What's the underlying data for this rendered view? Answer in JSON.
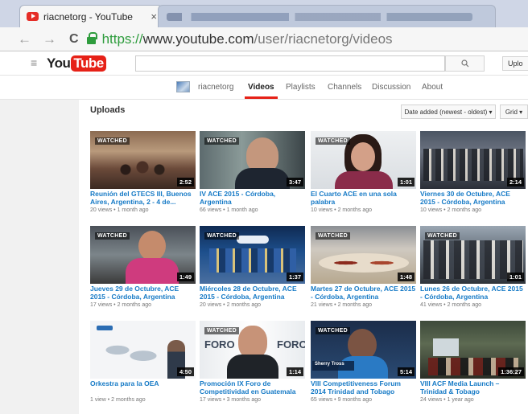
{
  "browser": {
    "tab_title": "riacnetorg - YouTube",
    "tab_close": "×",
    "url_https": "https://",
    "url_host": "www.youtube.com",
    "url_path": "/user/riacnetorg/videos",
    "back": "←",
    "forward": "→",
    "reload": "C"
  },
  "header": {
    "logo_you": "You",
    "logo_tube": "Tube",
    "upload_label": "Uplo"
  },
  "channel_nav": {
    "name": "riacnetorg",
    "tabs": [
      "Videos",
      "Playlists",
      "Channels",
      "Discussion",
      "About"
    ],
    "active": "Videos"
  },
  "uploads": {
    "title": "Uploads",
    "sort_label": "Date added (newest - oldest) ▾",
    "view_label": "Grid ▾"
  },
  "watched_label": "WATCHED",
  "videos": [
    {
      "title": "Reunión del GTECS III, Buenos Aires, Argentina, 2 - 4 de...",
      "meta": "20 views • 1 month ago",
      "duration": "2:52",
      "watched": true
    },
    {
      "title": "IV ACE 2015 - Córdoba, Argentina",
      "meta": "66 views • 1 month ago",
      "duration": "3:47",
      "watched": true
    },
    {
      "title": "El Cuarto ACE en una sola palabra",
      "meta": "10 views • 2 months ago",
      "duration": "1:01",
      "watched": true
    },
    {
      "title": "Viernes 30 de Octubre, ACE 2015 - Córdoba, Argentina",
      "meta": "10 views • 2 months ago",
      "duration": "2:14",
      "watched": false
    },
    {
      "title": "Jueves 29 de Octubre, ACE 2015 - Córdoba, Argentina",
      "meta": "17 views • 2 months ago",
      "duration": "1:49",
      "watched": true
    },
    {
      "title": "Miércoles 28 de Octubre, ACE 2015 - Córdoba, Argentina",
      "meta": "20 views • 2 months ago",
      "duration": "1:37",
      "watched": true
    },
    {
      "title": "Martes 27 de Octubre, ACE 2015 - Córdoba, Argentina",
      "meta": "21 views • 2 months ago",
      "duration": "1:48",
      "watched": true
    },
    {
      "title": "Lunes 26 de Octubre, ACE 2015 - Córdoba, Argentina",
      "meta": "41 views • 2 months ago",
      "duration": "1:01",
      "watched": true
    },
    {
      "title": "Orkestra para la OEA",
      "meta": "1 view • 2 months ago",
      "duration": "4:50",
      "watched": false
    },
    {
      "title": "Promoción IX Foro de Competitividad en Guatemala -...",
      "meta": "17 views • 3 months ago",
      "duration": "1:14",
      "watched": true
    },
    {
      "title": "VIII Competitiveness Forum 2014 Trinidad and Tobago",
      "meta": "65 views • 9 months ago",
      "duration": "5:14",
      "watched": true
    },
    {
      "title": "VIII ACF Media Launch – Trinidad & Tobago",
      "meta": "24 views • 1 year ago",
      "duration": "1:36:27",
      "watched": false
    }
  ],
  "thumb_overlays": {
    "foro": "FORO",
    "sherry": "Sherry Tross"
  },
  "colors": {
    "youtube_red": "#e62117",
    "link_blue": "#167ac6",
    "secure_green": "#2e9c3d"
  }
}
